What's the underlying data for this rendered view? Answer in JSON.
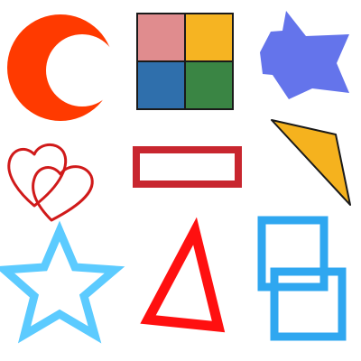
{
  "shapes": [
    {
      "name": "crescent-moon",
      "kind": "crescent",
      "color": "#FF3A00"
    },
    {
      "name": "four-color-square",
      "kind": "quad-square",
      "colors": [
        "#E08C8E",
        "#F6B422",
        "#2F6FAC",
        "#3A8544"
      ],
      "stroke": "#1a1a1a"
    },
    {
      "name": "six-pointed-star",
      "kind": "hexagram",
      "color": "#6474EB"
    },
    {
      "name": "double-hearts",
      "kind": "hearts-outline",
      "color": "#D01A1A"
    },
    {
      "name": "rectangle-outline",
      "kind": "rect-outline",
      "color": "#C8262F"
    },
    {
      "name": "yellow-triangle",
      "kind": "triangle-filled",
      "color": "#F5B21E",
      "stroke": "#1a1a1a"
    },
    {
      "name": "star-outline",
      "kind": "pentagram-outline",
      "color": "#5CCBFF"
    },
    {
      "name": "triangle-outline",
      "kind": "triangle-outline",
      "color": "#FF1010"
    },
    {
      "name": "overlapping-squares",
      "kind": "double-square-outline",
      "color": "#2FA7F0"
    }
  ]
}
